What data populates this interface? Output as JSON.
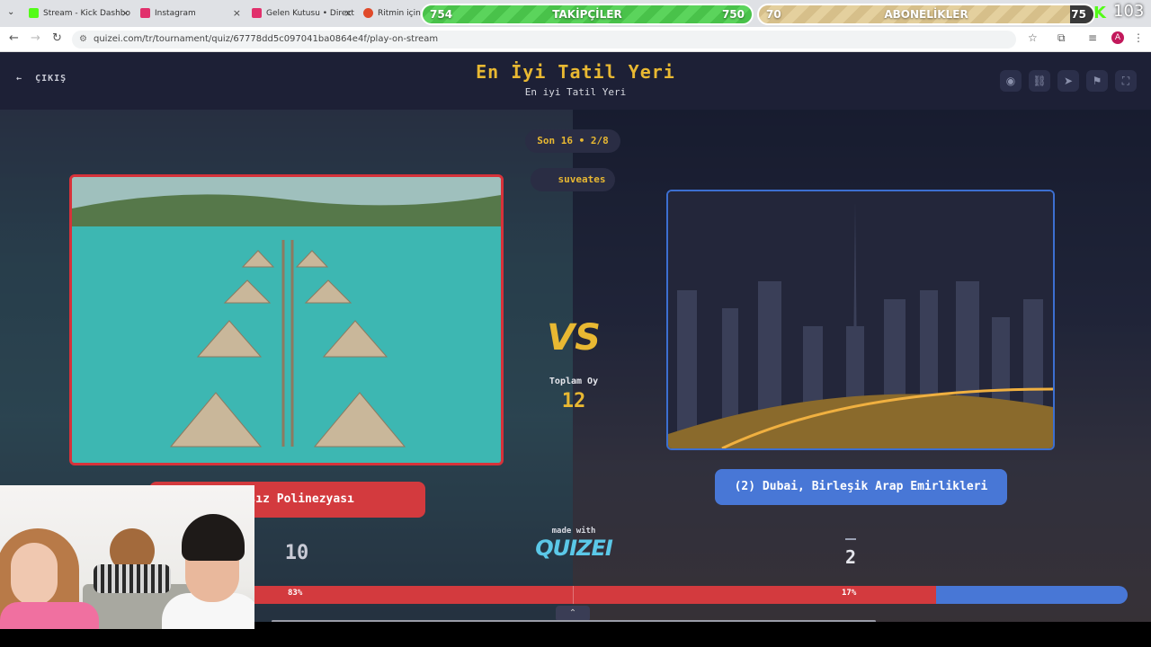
{
  "browser": {
    "tabs": [
      {
        "label": "Stream - Kick Dashbo",
        "color": "#53fc18"
      },
      {
        "label": "Instagram",
        "color": "#e1306c"
      },
      {
        "label": "Gelen Kutusu • Direct",
        "color": "#e1306c"
      },
      {
        "label": "Ritmin içinde",
        "color": "#e04a2a"
      }
    ],
    "url": "quizei.com/tr/tournament/quiz/67778dd5c097041ba0864e4f/play-on-stream",
    "profile_initial": "A"
  },
  "overlay": {
    "followers": {
      "left": "754",
      "label": "TAKİPÇİLER",
      "right": "750"
    },
    "subs": {
      "left": "70",
      "label": "ABONELİKLER",
      "right": "75"
    },
    "viewer_count": "103"
  },
  "header": {
    "exit_label": "ÇIKIŞ",
    "title": "En İyi Tatil Yeri",
    "subtitle": "En iyi Tatil Yeri",
    "buttons": [
      "eye-icon",
      "link-icon",
      "send-icon",
      "flag-icon",
      "fullscreen-icon"
    ]
  },
  "round": {
    "label": "Son 16 • 2/8",
    "streamer": "suveates"
  },
  "vs_label": "VS",
  "total": {
    "label": "Toplam Oy",
    "value": "12"
  },
  "left_option": {
    "label": "Fransız Polinezyası",
    "votes": "10",
    "percent": "83%",
    "share": 0.83
  },
  "right_option": {
    "label": "(2) Dubai, Birleşik Arap Emirlikleri",
    "votes": "2",
    "percent": "17%"
  },
  "branding": {
    "made_with": "made with",
    "name": "QUIZEI"
  },
  "colors": {
    "accent": "#e8b832",
    "left": "#d33a3e",
    "right": "#4877d6"
  }
}
